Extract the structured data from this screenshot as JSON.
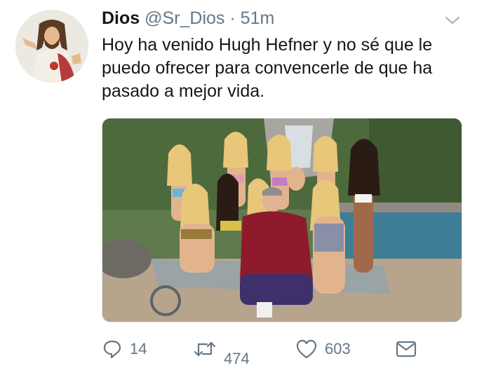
{
  "tweet": {
    "display_name": "Dios",
    "handle": "@Sr_Dios",
    "separator": "·",
    "time": "51m",
    "text": "Hoy ha venido Hugh Hefner y no sé que le puedo ofrecer para convencerle de que ha pasado a mejor vida.",
    "caret_icon": "chevron-down-icon",
    "avatar": "jesus-avatar",
    "media": "photo-group-by-pool"
  },
  "actions": {
    "reply_count": "14",
    "retweet_count": "474",
    "like_count": "603",
    "icons": [
      "reply-icon",
      "retweet-icon",
      "heart-icon",
      "envelope-icon"
    ]
  },
  "colors": {
    "text": "#14171a",
    "muted": "#657786",
    "border": "#e1e8ed"
  }
}
